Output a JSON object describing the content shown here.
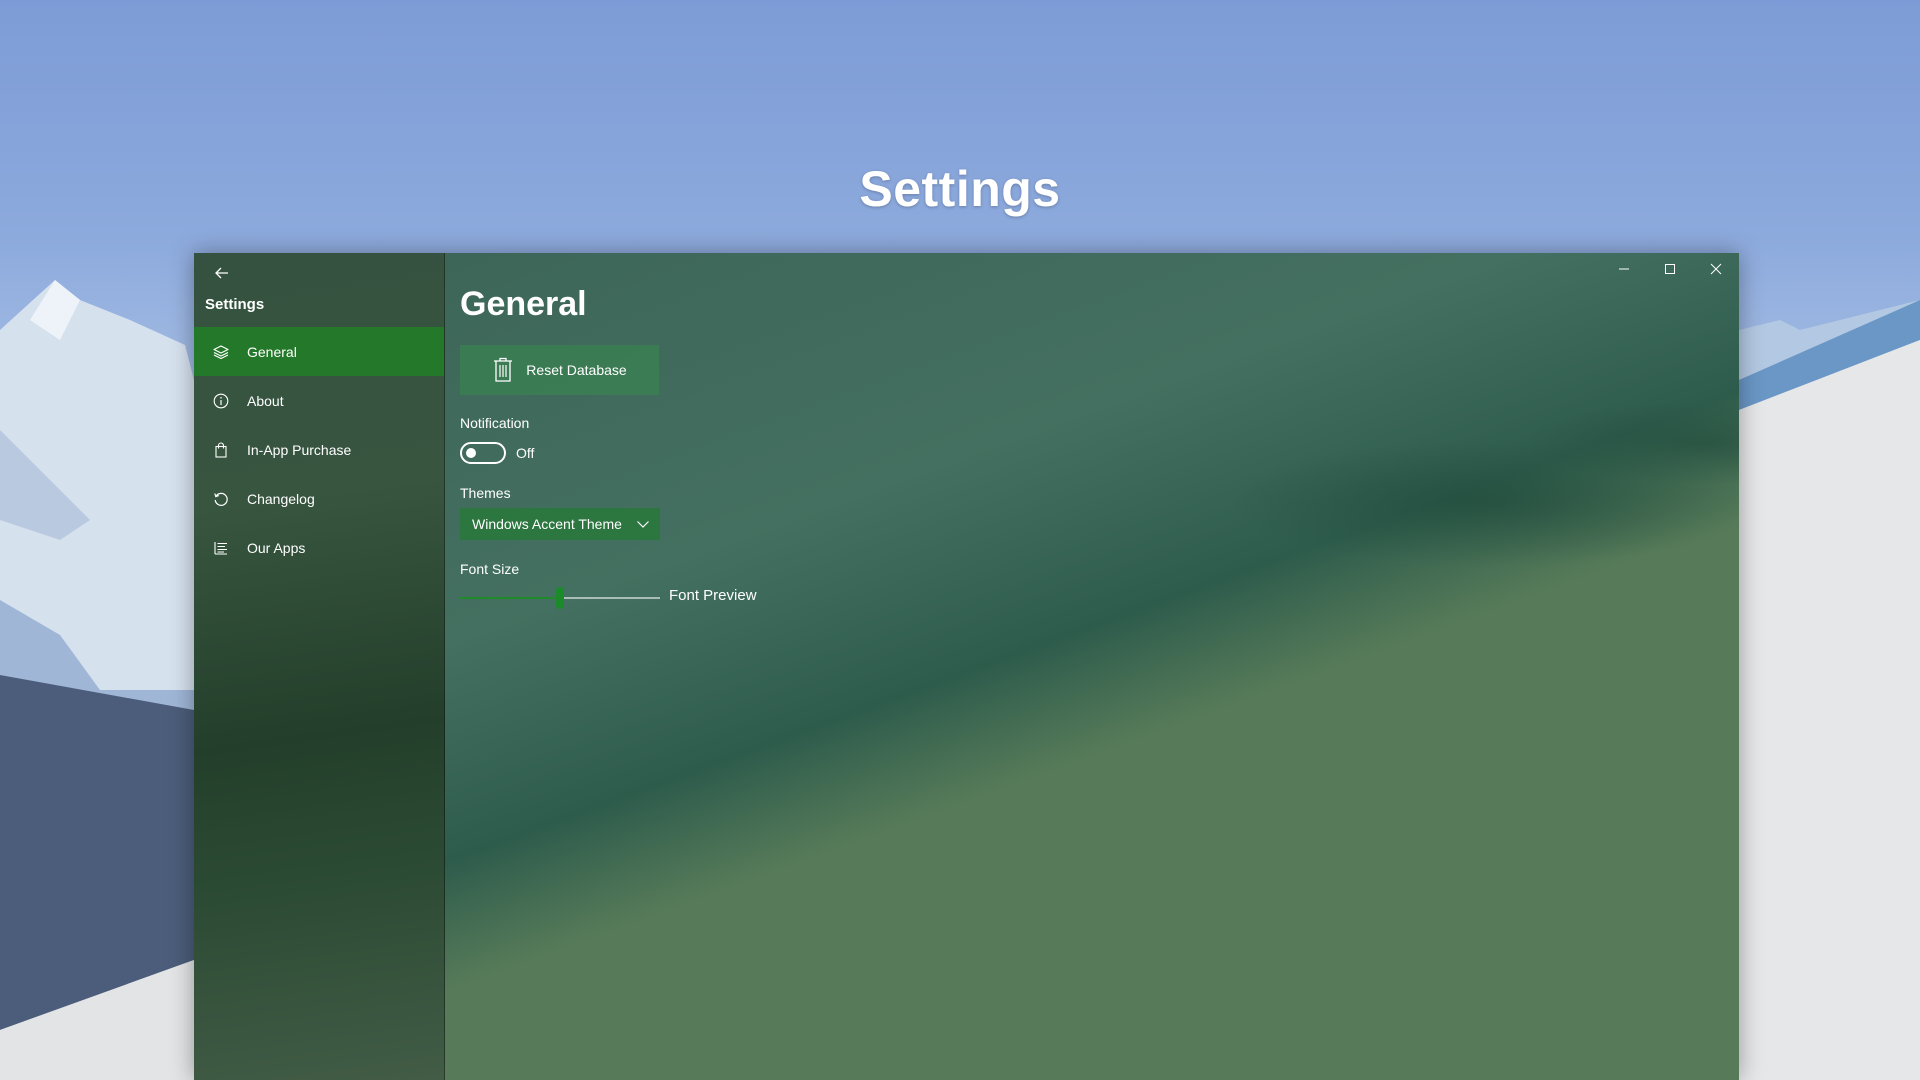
{
  "page": {
    "title": "Settings"
  },
  "window": {
    "pane_title": "Settings",
    "nav": [
      {
        "label": "General",
        "icon": "layers-icon",
        "selected": true
      },
      {
        "label": "About",
        "icon": "info-icon",
        "selected": false
      },
      {
        "label": "In-App Purchase",
        "icon": "shopping-bag-icon",
        "selected": false
      },
      {
        "label": "Changelog",
        "icon": "history-icon",
        "selected": false
      },
      {
        "label": "Our Apps",
        "icon": "list-icon",
        "selected": false
      }
    ],
    "caption_buttons": [
      "minimize-icon",
      "maximize-icon",
      "close-icon"
    ]
  },
  "content": {
    "title": "General",
    "reset_button": {
      "label": "Reset Database",
      "icon": "trash-icon"
    },
    "notification": {
      "label": "Notification",
      "state_text": "Off",
      "on": false
    },
    "themes": {
      "label": "Themes",
      "selected": "Windows Accent Theme"
    },
    "font_size": {
      "label": "Font Size",
      "level_fraction": 0.5,
      "preview_text": "Font Preview"
    }
  },
  "colors": {
    "accent": "#24782a",
    "slider_accent": "#1a8b28"
  }
}
